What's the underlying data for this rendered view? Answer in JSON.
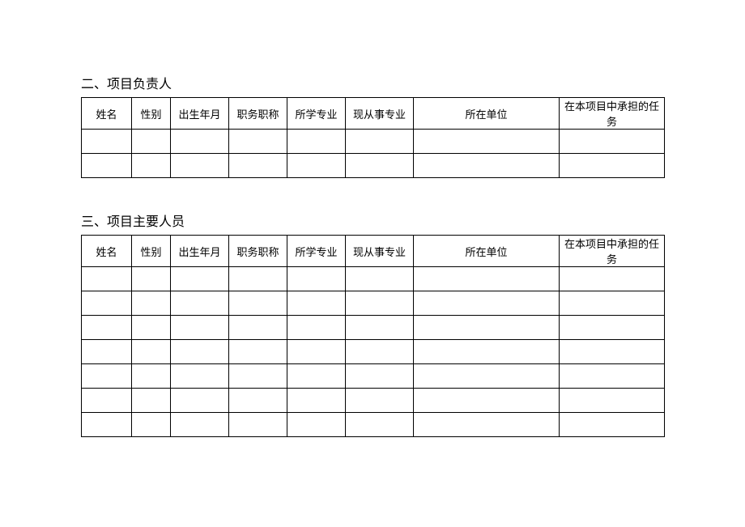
{
  "section1": {
    "title": "二、项目负责人",
    "headers": [
      "姓名",
      "性别",
      "出生年月",
      "职务职称",
      "所学专业",
      "现从事专业",
      "所在单位",
      "在本项目中承担的任务"
    ],
    "rows": [
      [
        "",
        "",
        "",
        "",
        "",
        "",
        "",
        ""
      ],
      [
        "",
        "",
        "",
        "",
        "",
        "",
        "",
        ""
      ]
    ]
  },
  "section2": {
    "title": "三、项目主要人员",
    "headers": [
      "姓名",
      "性别",
      "出生年月",
      "职务职称",
      "所学专业",
      "现从事专业",
      "所在单位",
      "在本项目中承担的任务"
    ],
    "rows": [
      [
        "",
        "",
        "",
        "",
        "",
        "",
        "",
        ""
      ],
      [
        "",
        "",
        "",
        "",
        "",
        "",
        "",
        ""
      ],
      [
        "",
        "",
        "",
        "",
        "",
        "",
        "",
        ""
      ],
      [
        "",
        "",
        "",
        "",
        "",
        "",
        "",
        ""
      ],
      [
        "",
        "",
        "",
        "",
        "",
        "",
        "",
        ""
      ],
      [
        "",
        "",
        "",
        "",
        "",
        "",
        "",
        ""
      ],
      [
        "",
        "",
        "",
        "",
        "",
        "",
        "",
        ""
      ]
    ]
  }
}
